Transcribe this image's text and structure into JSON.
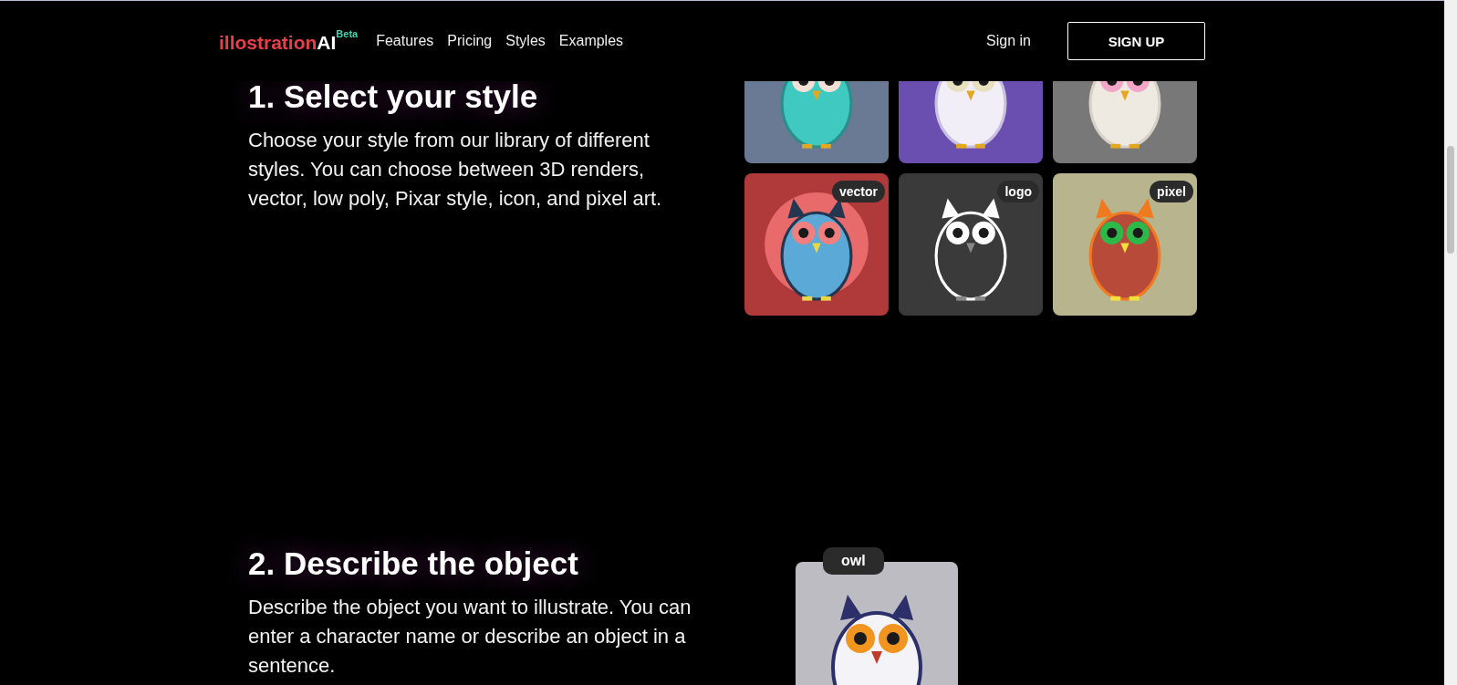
{
  "nav": {
    "logo": {
      "name": "illostration",
      "suffix": "AI",
      "badge": "Beta"
    },
    "links": [
      "Features",
      "Pricing",
      "Styles",
      "Examples"
    ],
    "sign_in": "Sign in",
    "sign_up": "SIGN UP"
  },
  "sections": [
    {
      "heading": "1. Select your style",
      "text": "Choose your style from our library of different styles. You can choose between 3D renders, vector, low poly, Pixar style, icon, and pixel art.",
      "gallery": [
        {
          "kind": "picture"
        },
        {
          "kind": "picture"
        },
        {
          "kind": "picture"
        },
        {
          "kind": "picture",
          "tag": "vector"
        },
        {
          "kind": "picture",
          "tag": "logo"
        },
        {
          "kind": "picture",
          "tag": "pixel"
        }
      ]
    },
    {
      "heading": "2. Describe the object",
      "text": "Describe the object you want to illustrate. You can enter a character name or describe an object in a sentence.",
      "gallery": [
        {
          "kind": "picture",
          "tag": "owl"
        }
      ]
    }
  ]
}
